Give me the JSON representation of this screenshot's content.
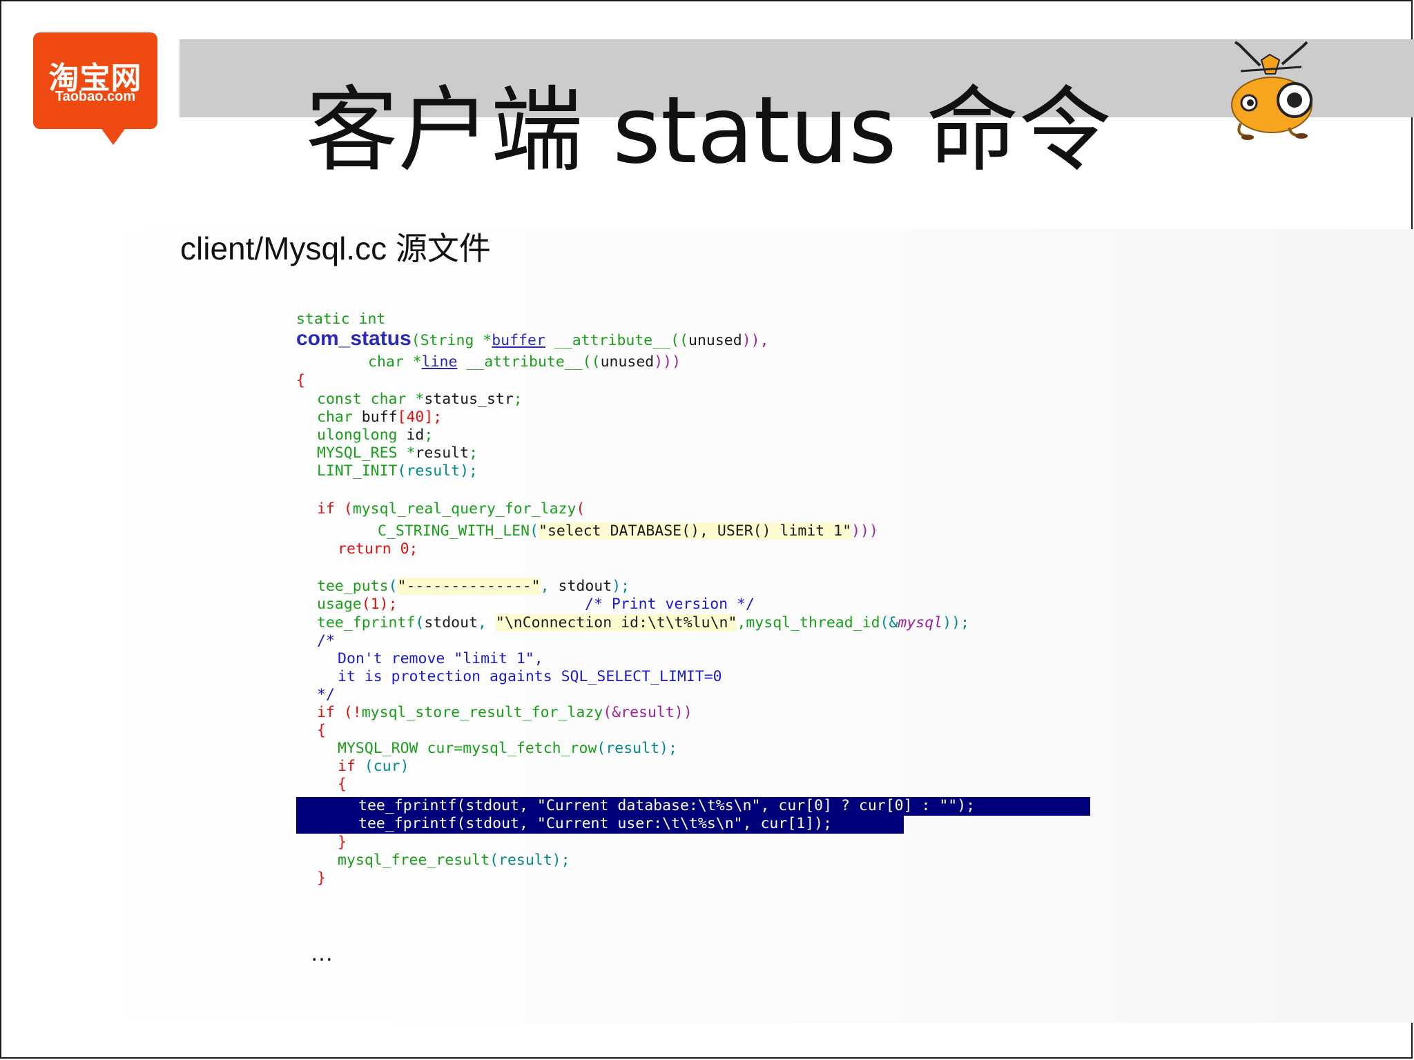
{
  "logo": {
    "cn": "淘宝网",
    "en": "Taobao.com"
  },
  "slide": {
    "title": "客户端 status 命令",
    "subtitle": "client/Mysql.cc 源文件",
    "ellipsis": "…"
  },
  "colors": {
    "header_bar": "#cccccc",
    "logo_bg": "#ee4a12",
    "selection": "#00007a",
    "string_highlight": "#fdfbcf"
  },
  "code": {
    "l01": "static int",
    "l02a": "com_status",
    "l02b": "(String *",
    "l02c": "buffer",
    "l02d": " __attribute__((",
    "l02e": "unused",
    "l02f": ")),",
    "l03a": "char *",
    "l03b": "line",
    "l03c": " __attribute__((",
    "l03d": "unused",
    "l03e": ")))",
    "l04": "{",
    "l05a": "const char *",
    "l05b": "status_str",
    "l05c": ";",
    "l06a": "char ",
    "l06b": "buff",
    "l06c": "[40];",
    "l07a": "ulonglong ",
    "l07b": "id",
    "l07c": ";",
    "l08a": "MYSQL_RES *",
    "l08b": "result",
    "l08c": ";",
    "l09a": "LINT_INIT",
    "l09b": "(result);",
    "l10a": "if ",
    "l10b": "(",
    "l10c": "mysql_real_query_for_lazy",
    "l10d": "(",
    "l11a": "C_STRING_WITH_LEN",
    "l11b": "(",
    "l11c": "\"select DATABASE(), USER() limit 1\"",
    "l11d": ")))",
    "l12a": "return ",
    "l12b": "0;",
    "l13a": "tee_puts",
    "l13b": "(",
    "l13c": "\"--------------\"",
    "l13d": ", ",
    "l13e": "stdout",
    "l13f": ");",
    "l14a": "usage",
    "l14b": "(1);",
    "l14c": "/* Print version */",
    "l15a": "tee_fprintf",
    "l15b": "(",
    "l15c": "stdout",
    "l15d": ", ",
    "l15e": "\"\\nConnection id:\\t\\t%lu\\n\"",
    "l15f": ",",
    "l15g": "mysql_thread_id",
    "l15h": "(&",
    "l15i": "mysql",
    "l15j": "));",
    "l16": "/*",
    "l17": "Don't remove \"limit 1\",",
    "l18": "it is protection againts SQL_SELECT_LIMIT=0",
    "l19": "*/",
    "l20a": "if ",
    "l20b": "(!",
    "l20c": "mysql_store_result_for_lazy",
    "l20d": "(&result))",
    "l21": "{",
    "l22a": "MYSQL_ROW ",
    "l22b": "cur=mysql_fetch_row",
    "l22c": "(result);",
    "l23a": "if ",
    "l23b": "(cur)",
    "l24": "{",
    "l25": "tee_fprintf(stdout, \"Current database:\\t%s\\n\", cur[0] ? cur[0] : \"\");",
    "l26": "tee_fprintf(stdout, \"Current user:\\t\\t%s\\n\", cur[1]);",
    "l27": "}",
    "l28a": "mysql_free_result",
    "l28b": "(result);",
    "l29": "}"
  }
}
